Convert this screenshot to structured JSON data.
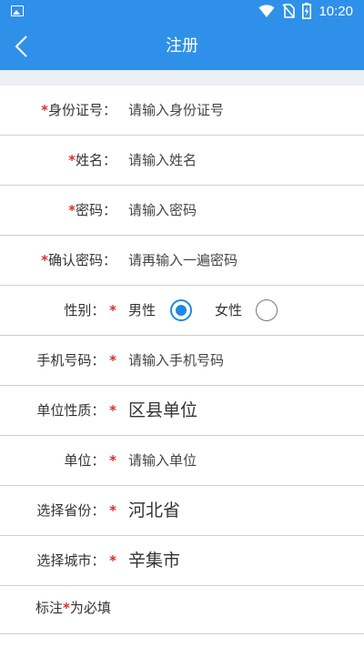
{
  "status_bar": {
    "time": "10:20",
    "icons": [
      "image-icon",
      "wifi-icon",
      "no-sim-icon",
      "battery-charging-icon"
    ]
  },
  "app_bar": {
    "title": "注册",
    "back_icon": "back-arrow-icon"
  },
  "form": {
    "id_number": {
      "label": "身份证号：",
      "placeholder": "请输入身份证号"
    },
    "name": {
      "label": "姓名：",
      "placeholder": "请输入姓名"
    },
    "password": {
      "label": "密码：",
      "placeholder": "请输入密码"
    },
    "confirm_password": {
      "label": "确认密码：",
      "placeholder": "请再输入一遍密码"
    },
    "gender": {
      "label": "性别：",
      "options": [
        {
          "label": "男性",
          "selected": true
        },
        {
          "label": "女性",
          "selected": false
        }
      ]
    },
    "phone": {
      "label": "手机号码：",
      "placeholder": "请输入手机号码"
    },
    "unit_type": {
      "label": "单位性质：",
      "value": "区县单位"
    },
    "unit": {
      "label": "单位：",
      "placeholder": "请输入单位"
    },
    "province": {
      "label": "选择省份：",
      "value": "河北省"
    },
    "city": {
      "label": "选择城市：",
      "value": "辛集市"
    },
    "required_star": "*",
    "note": {
      "prefix": "标注",
      "suffix": "为必填"
    }
  },
  "colors": {
    "primary": "#2f90e9",
    "required": "#d32f2f",
    "radio_selected": "#1e88e5",
    "divider": "#cfcfcf"
  }
}
